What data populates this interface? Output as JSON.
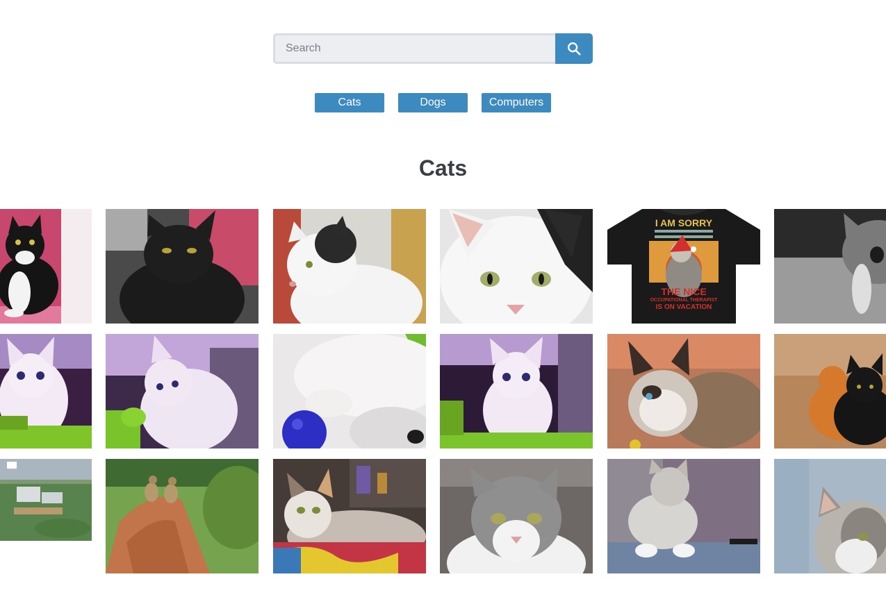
{
  "search": {
    "placeholder": "Search",
    "value": "",
    "button_icon": "search-icon"
  },
  "topics": [
    "Cats",
    "Dogs",
    "Computers"
  ],
  "heading": "Cats",
  "shirt_text": [
    "I AM SORRY",
    "THE NICE",
    "OCCUPATIONAL THERAPIST",
    "IS ON VACATION"
  ],
  "colors": {
    "accent": "#3d8ac0",
    "heading": "#3a3f46",
    "input_bg": "#eceef1",
    "input_border": "#d9dce1"
  },
  "photos": [
    [
      "black and white cat on pink",
      "black cat on pink blanket",
      "white cat with black patch in profile",
      "white and black cat close-up face",
      "black t-shirt with cat print",
      "grey kitten black and white photo"
    ],
    [
      "white kitten in green basket",
      "white kitten playing in basket",
      "white cat paw with blue ball",
      "white kitten sitting in green basket",
      "siamese-mix cat lying down",
      "orange and black kittens"
    ],
    [
      "aerial view of campus",
      "cheetah cubs on termite mound",
      "calico cat on colorful blanket",
      "grey and white cat portrait",
      "tabby cat relaxing",
      "grey tabby cat close-up"
    ]
  ]
}
